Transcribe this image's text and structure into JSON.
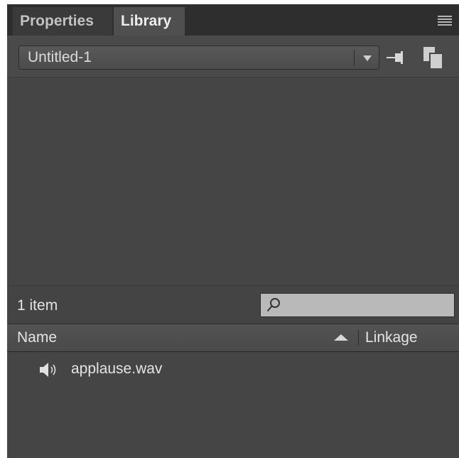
{
  "tabs": [
    {
      "label": "Properties",
      "active": false
    },
    {
      "label": "Library",
      "active": true
    }
  ],
  "library_selector": {
    "selected": "Untitled-1"
  },
  "icons": {
    "panel_menu": "hamburger-menu-icon",
    "pin": "pin-icon",
    "new_library": "new-library-panel-icon",
    "search": "magnifier-icon",
    "sort": "sort-ascending-icon",
    "sound": "speaker-icon"
  },
  "info": {
    "item_count": "1 item",
    "search_value": ""
  },
  "columns": {
    "name": "Name",
    "linkage": "Linkage"
  },
  "items": [
    {
      "name": "applause.wav",
      "type": "sound"
    }
  ],
  "colors": {
    "panel_bg": "#464646",
    "tabbar_bg": "#2e2e2e",
    "active_tab_bg": "#4f4f4f",
    "text": "#e4e4e4",
    "search_bg": "#b9b9b9"
  }
}
